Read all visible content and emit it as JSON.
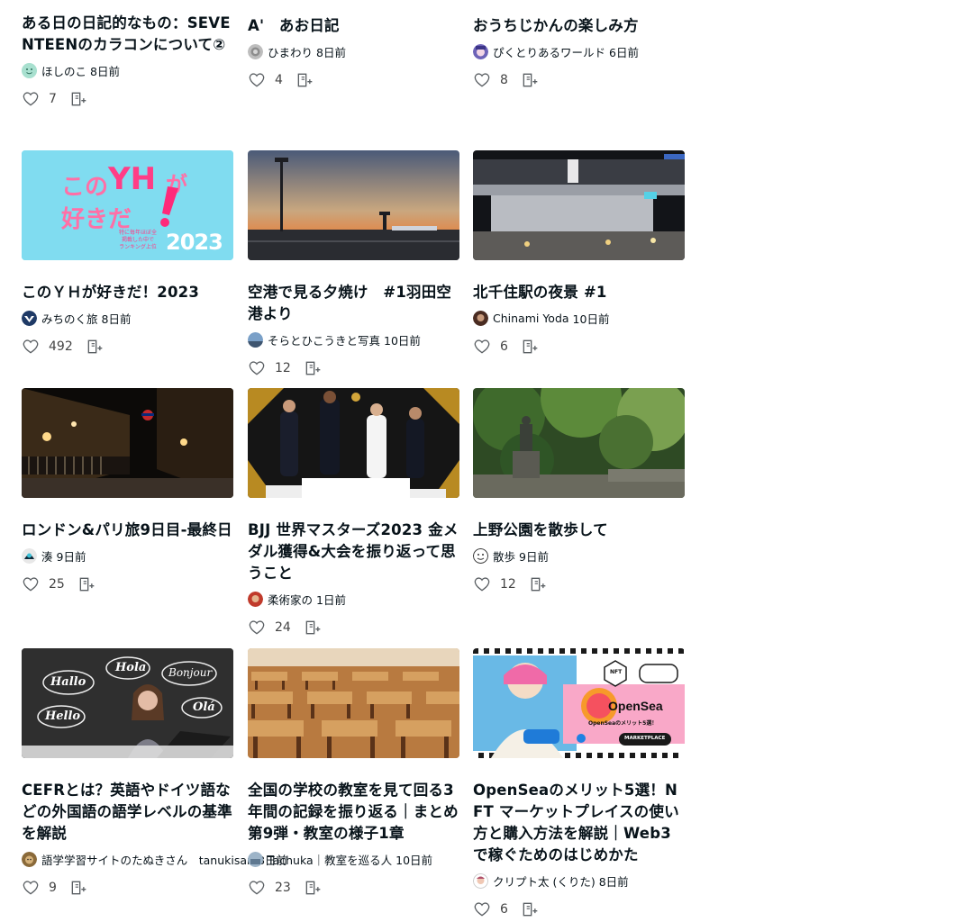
{
  "cards": [
    {
      "title": "ある日の日記的なもの：SEVENTEENのカラコンについて②",
      "author": "ほしのこ",
      "date": "8日前",
      "likes": "7"
    },
    {
      "title": "A'　あお日記",
      "author": "ひまわり",
      "date": "8日前",
      "likes": "4"
    },
    {
      "title": "おうちじかんの楽しみ方",
      "author": "ぴくとりあるワールド",
      "date": "6日前",
      "likes": "8"
    },
    {
      "title": "このＹＨが好きだ！2023",
      "author": "みちのく旅",
      "date": "8日前",
      "likes": "492"
    },
    {
      "title": "空港で見る夕焼け　#1羽田空港より",
      "author": "そらとひこうきと写真",
      "date": "10日前",
      "likes": "12"
    },
    {
      "title": "北千住駅の夜景 #1",
      "author": "Chinami Yoda",
      "date": "10日前",
      "likes": "6"
    },
    {
      "title": "ロンドン&パリ旅9日目-最終日",
      "author": "湊",
      "date": "9日前",
      "likes": "25"
    },
    {
      "title": "BJJ 世界マスターズ2023 金メダル獲得&大会を振り返って思うこと",
      "author": "柔術家の",
      "date": "1日前",
      "likes": "24"
    },
    {
      "title": "上野公園を散歩して",
      "author": "散歩",
      "date": "9日前",
      "likes": "12"
    },
    {
      "title": "CEFRとは？英語やドイツ語などの外国語の語学レベルの基準を解説",
      "author": "語学学習サイトのたぬきさん　tanukisan",
      "date": "8日前",
      "likes": "9"
    },
    {
      "title": "全国の学校の教室を見て回る3年間の記録を振り返る｜まとめ第9弾・教室の様子1章",
      "author": "Tachuka｜教室を巡る人",
      "date": "10日前",
      "likes": "23"
    },
    {
      "title": "OpenSeaのメリット5選！NFT マーケットプレイスの使い方と購入方法を解説｜Web3 で稼ぐためのはじめかた",
      "author": "クリプト太 (くりた)",
      "date": "8日前",
      "likes": "6"
    }
  ],
  "thumbnails": {
    "yh_line1": "この",
    "yh_big": "YH",
    "yh_ga": "が",
    "yh_line2": "好きだ",
    "yh_year": "2023",
    "yh_small1": "特に毎年ほぼ全",
    "yh_small2": "掲載した中で",
    "yh_small3": "ランキング上位",
    "cefr_hallo": "Hallo",
    "cefr_hola": "Hola",
    "cefr_bonjour": "Bonjour",
    "cefr_hello": "Hello",
    "cefr_ola": "Olá",
    "opensea_name": "OpenSea",
    "opensea_tag": "OpenSeaのメリット5選！",
    "opensea_market": "MARKETPLACE",
    "opensea_nft": "NFT"
  },
  "colors": {
    "accent": "#08131a",
    "icon": "#5a5f63"
  }
}
